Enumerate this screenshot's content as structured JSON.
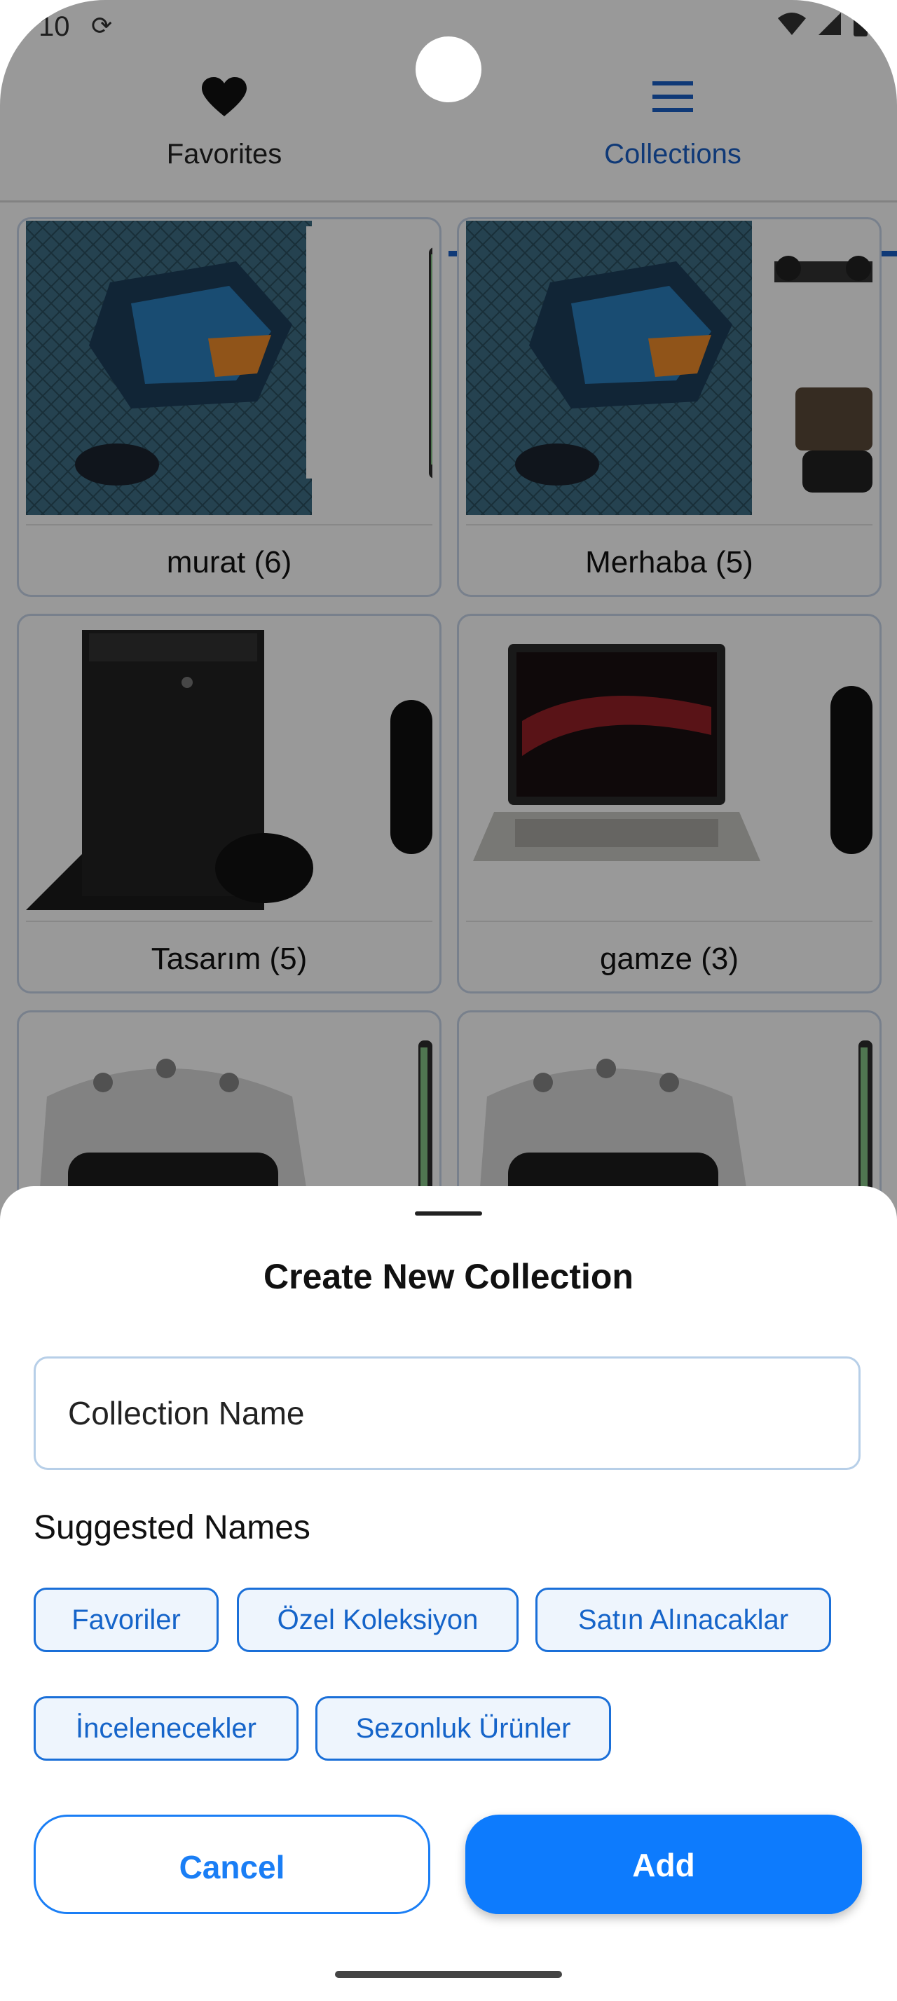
{
  "status_bar": {
    "time": "10"
  },
  "tabs": [
    {
      "label": "Favorites",
      "icon": "heart-icon",
      "active": false
    },
    {
      "label": "Collections",
      "icon": "menu-icon",
      "active": true
    }
  ],
  "collections": [
    {
      "title": "murat (6)",
      "image": "headphones-case"
    },
    {
      "title": "Merhaba (5)",
      "image": "headphones-case-drone"
    },
    {
      "title": "Tasarım (5)",
      "image": "game-console"
    },
    {
      "title": "gamze (3)",
      "image": "laptop"
    },
    {
      "title": "",
      "image": "vr-headset"
    },
    {
      "title": "",
      "image": "vr-headset"
    }
  ],
  "sheet": {
    "title": "Create New Collection",
    "input_placeholder": "Collection Name",
    "suggested_heading": "Suggested Names",
    "suggestions": [
      "Favoriler",
      "Özel Koleksiyon",
      "Satın Alınacaklar",
      "İncelenecekler",
      "Sezonluk Ürünler"
    ],
    "cancel_label": "Cancel",
    "add_label": "Add"
  },
  "colors": {
    "accent": "#1a5fc6",
    "button_primary": "#0d7bfd",
    "chip_border": "#1a6fd8",
    "chip_bg": "#eef5fd"
  }
}
